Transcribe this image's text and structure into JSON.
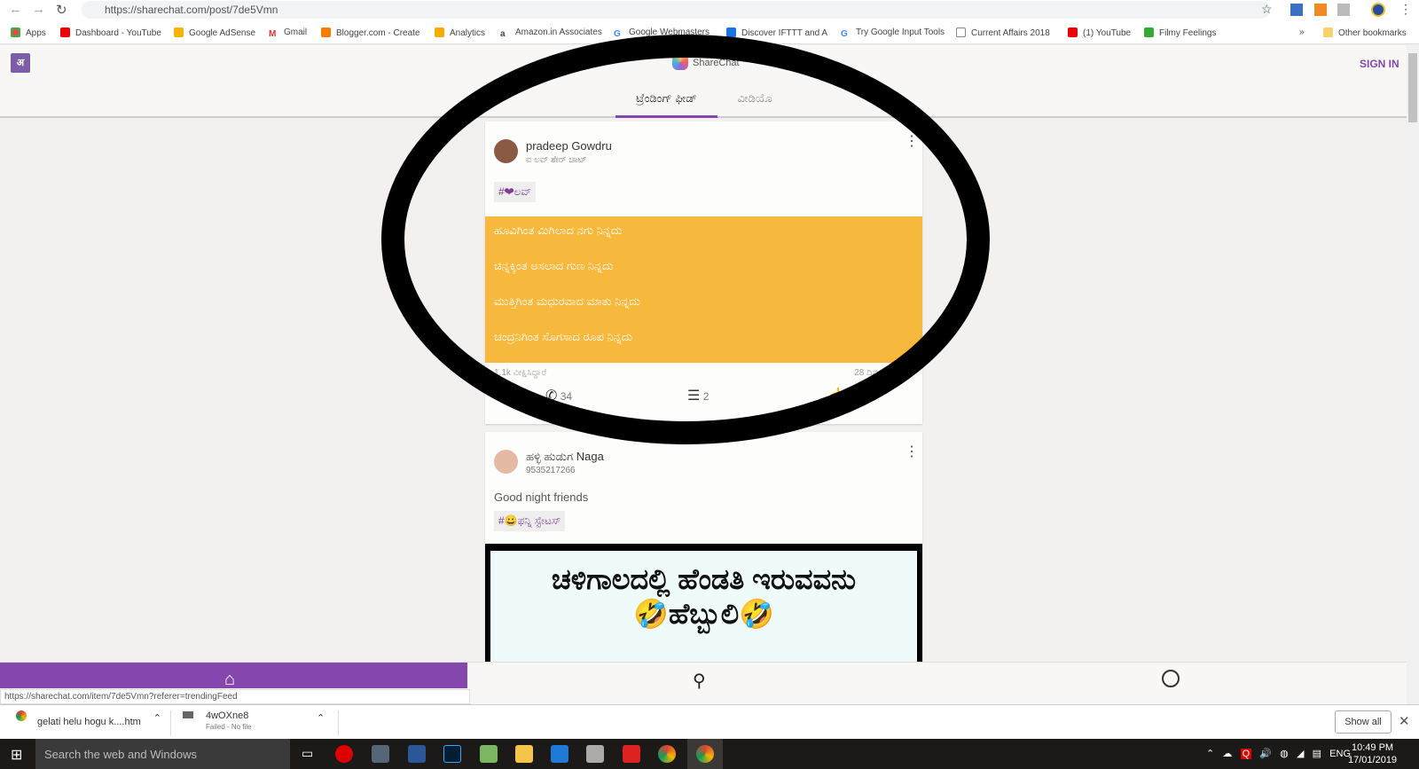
{
  "browser": {
    "url": "https://sharechat.com/post/7de5Vmn",
    "bookmarks": [
      "Apps",
      "Dashboard - YouTube",
      "Google AdSense",
      "Gmail",
      "Blogger.com - Create",
      "Analytics",
      "Amazon.in Associates",
      "Google Webmasters",
      "Discover IFTTT and A",
      "Try Google Input Tools",
      "Current Affairs 2018",
      "(1) YouTube",
      "Filmy Feelings"
    ],
    "more": "»",
    "other_bookmarks": "Other bookmarks"
  },
  "app": {
    "logo": "ShareChat",
    "sign_in": "SIGN IN",
    "translate_icon": "अ",
    "tabs": [
      {
        "label": "ಟ್ರೆಂಡಿಂಗ್ ಫೀಡ್",
        "active": true
      },
      {
        "label": "ವೀಡಿಯೊ",
        "active": false
      }
    ]
  },
  "posts": [
    {
      "author": "pradeep Gowdru",
      "subtitle": "ಐ ಲವ್ ಶೇರ್ ಚಾಟ್",
      "tag": "#❤ಲವ್",
      "lines": [
        "ಹೂವಿಗಿಂತ ಮಿಗಿಲಾದ ನಗು ನಿನ್ನದು",
        "ಚಿನ್ನಕ್ಕಿಂತ ಅಸಲಾದ ಗುಣ ನಿನ್ನದು",
        "ಮುತ್ತಿಗಿಂತ ಮಧುರವಾದ ಮಾತು ನಿನ್ನದು",
        "ಚಂದ್ರನಿಗಿಂತ ಸೊಗಸಾದ ರೂಪ ನಿನ್ನದು"
      ],
      "band_color": "#f6b93e",
      "views": "1.1k ವೀಕ್ಷಿಸಿದ್ದಾರೆ",
      "time": "28 ದಿನಗಳ",
      "shares": "34",
      "comments": "2"
    },
    {
      "author": "ಹಳ್ಳಿ ಹುಡುಗ Naga",
      "subtitle": "9535217266",
      "caption": "Good night friends",
      "tag": "#😀ಫನ್ನಿ ಸ್ಟೇಟಸ್",
      "image_text": [
        "ಚಳಿಗಾಲದಲ್ಲಿ ಹೆಂಡತಿ ಇರುವವನು",
        "🤣ಹೆಬ್ಬುಲಿ🤣"
      ]
    }
  ],
  "status_url": "https://sharechat.com/item/7de5Vmn?referer=trendingFeed",
  "downloads": [
    {
      "name": "gelati helu hogu k....htm"
    },
    {
      "name": "4wOXne8",
      "status": "Failed - No file"
    }
  ],
  "show_all": "Show all",
  "taskbar": {
    "search": "Search the web and Windows",
    "lang": "ENG",
    "time": "10:49 PM",
    "date": "17/01/2019"
  },
  "accent": "#8546ad"
}
